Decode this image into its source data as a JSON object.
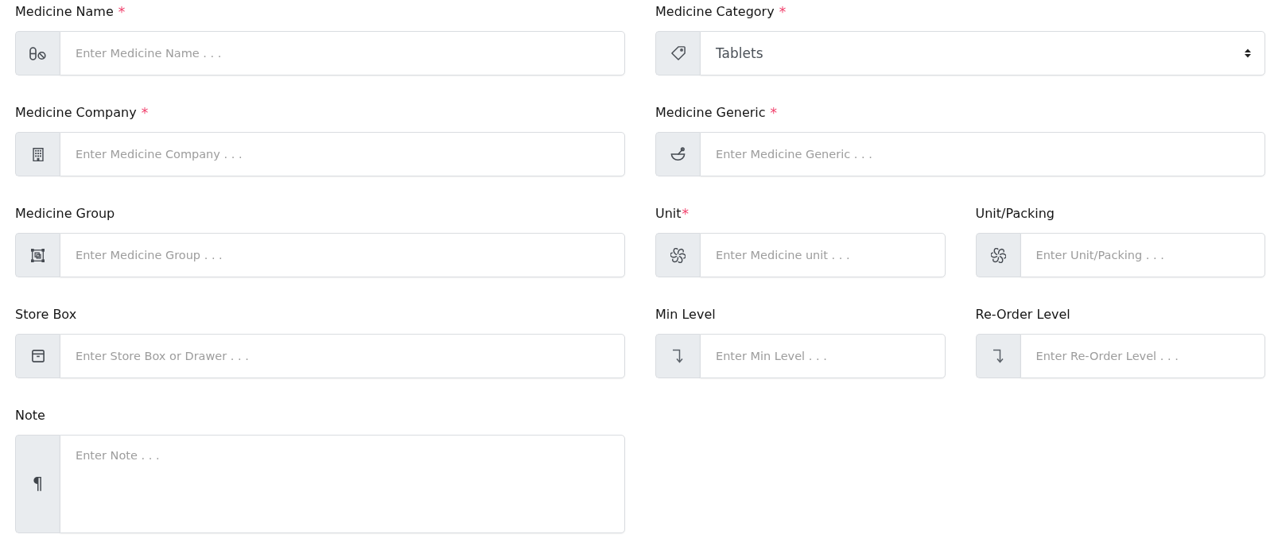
{
  "required_mark": "*",
  "rows": [
    {
      "fields": [
        {
          "kind": "text",
          "label": "Medicine Name",
          "required": true,
          "placeholder": "Enter Medicine Name . . ."
        },
        {
          "kind": "select",
          "label": "Medicine Category",
          "required": true,
          "value": "Tablets"
        }
      ]
    },
    {
      "fields": [
        {
          "kind": "text",
          "label": "Medicine Company",
          "required": true,
          "placeholder": "Enter Medicine Company . . ."
        },
        {
          "kind": "text",
          "label": "Medicine Generic",
          "required": true,
          "placeholder": "Enter Medicine Generic . . ."
        }
      ]
    },
    {
      "fields": [
        {
          "kind": "text",
          "label": "Medicine Group",
          "required": false,
          "placeholder": "Enter Medicine Group . . ."
        },
        {
          "kind": "text",
          "label": "Unit",
          "required": true,
          "placeholder": "Enter Medicine unit . . ."
        },
        {
          "kind": "text",
          "label": "Unit/Packing",
          "required": false,
          "placeholder": "Enter Unit/Packing . . ."
        }
      ]
    },
    {
      "fields": [
        {
          "kind": "text",
          "label": "Store Box",
          "required": false,
          "placeholder": "Enter Store Box or Drawer . . ."
        },
        {
          "kind": "text",
          "label": "Min Level",
          "required": false,
          "placeholder": "Enter Min Level . . ."
        },
        {
          "kind": "text",
          "label": "Re-Order Level",
          "required": false,
          "placeholder": "Enter Re-Order Level . . ."
        }
      ]
    },
    {
      "fields": [
        {
          "kind": "textarea",
          "label": "Note",
          "required": false,
          "placeholder": "Enter Note . . .",
          "symbol": "¶"
        }
      ]
    }
  ]
}
